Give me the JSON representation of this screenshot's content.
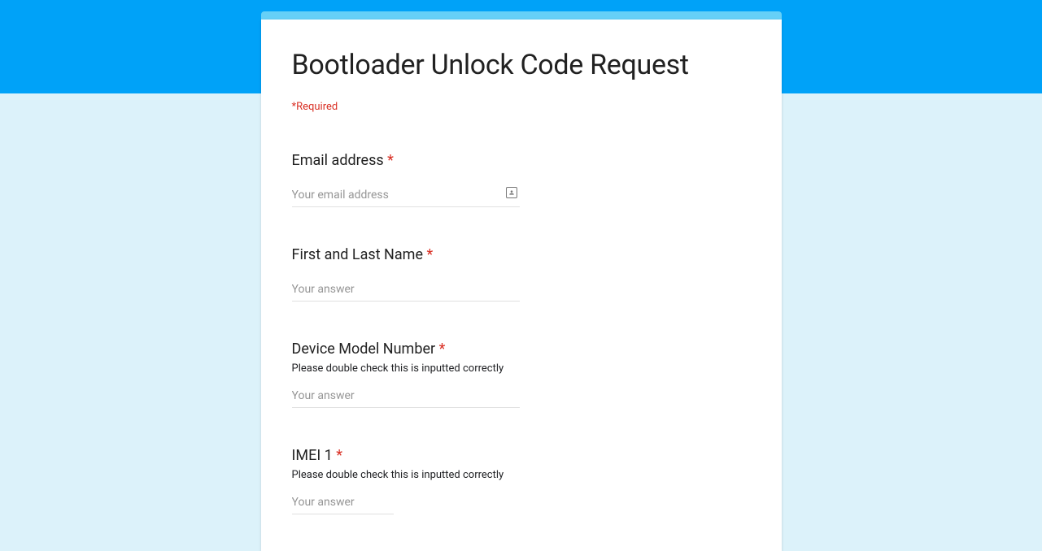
{
  "form": {
    "title": "Bootloader Unlock Code Request",
    "required_text": "*Required",
    "required_star": "*",
    "fields": {
      "email": {
        "label": "Email address ",
        "placeholder": "Your email address"
      },
      "name": {
        "label": "First and Last Name ",
        "placeholder": "Your answer"
      },
      "device": {
        "label": "Device Model Number ",
        "hint": "Please double check this is inputted correctly",
        "placeholder": "Your answer"
      },
      "imei1": {
        "label": "IMEI 1 ",
        "hint": "Please double check this is inputted correctly",
        "placeholder": "Your answer"
      }
    }
  }
}
